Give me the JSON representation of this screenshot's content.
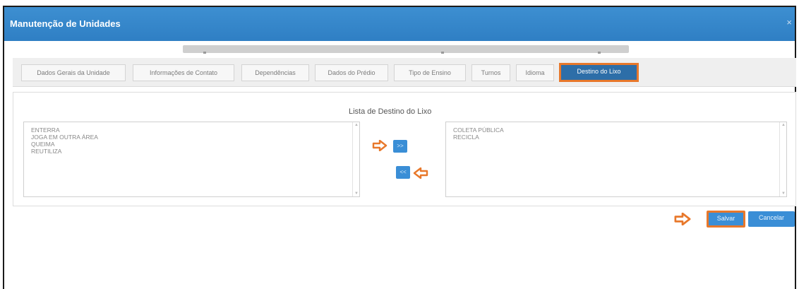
{
  "window": {
    "title": "Manutenção de Unidades",
    "close_glyph": "×"
  },
  "tabs": [
    {
      "label": "Dados Gerais da Unidade",
      "active": false
    },
    {
      "label": "Informações de Contato",
      "active": false
    },
    {
      "label": "Dependências",
      "active": false
    },
    {
      "label": "Dados do Prédio",
      "active": false
    },
    {
      "label": "Tipo de Ensino",
      "active": false
    },
    {
      "label": "Turnos",
      "active": false
    },
    {
      "label": "Idioma",
      "active": false
    },
    {
      "label": "Destino do Lixo",
      "active": true
    }
  ],
  "panel": {
    "title": "Lista de Destino do Lixo",
    "available": [
      "ENTERRA",
      "JOGA EM OUTRA ÁREA",
      "QUEIMA",
      "REUTILIZA"
    ],
    "selected": [
      "COLETA PÚBLICA",
      "RECICLA"
    ],
    "add_button": ">>",
    "remove_button": "<<"
  },
  "actions": {
    "save": "Salvar",
    "cancel": "Cancelar"
  },
  "colors": {
    "accent": "#3a8ed6",
    "highlight": "#e8782b",
    "active_tab": "#2d6ea8"
  }
}
